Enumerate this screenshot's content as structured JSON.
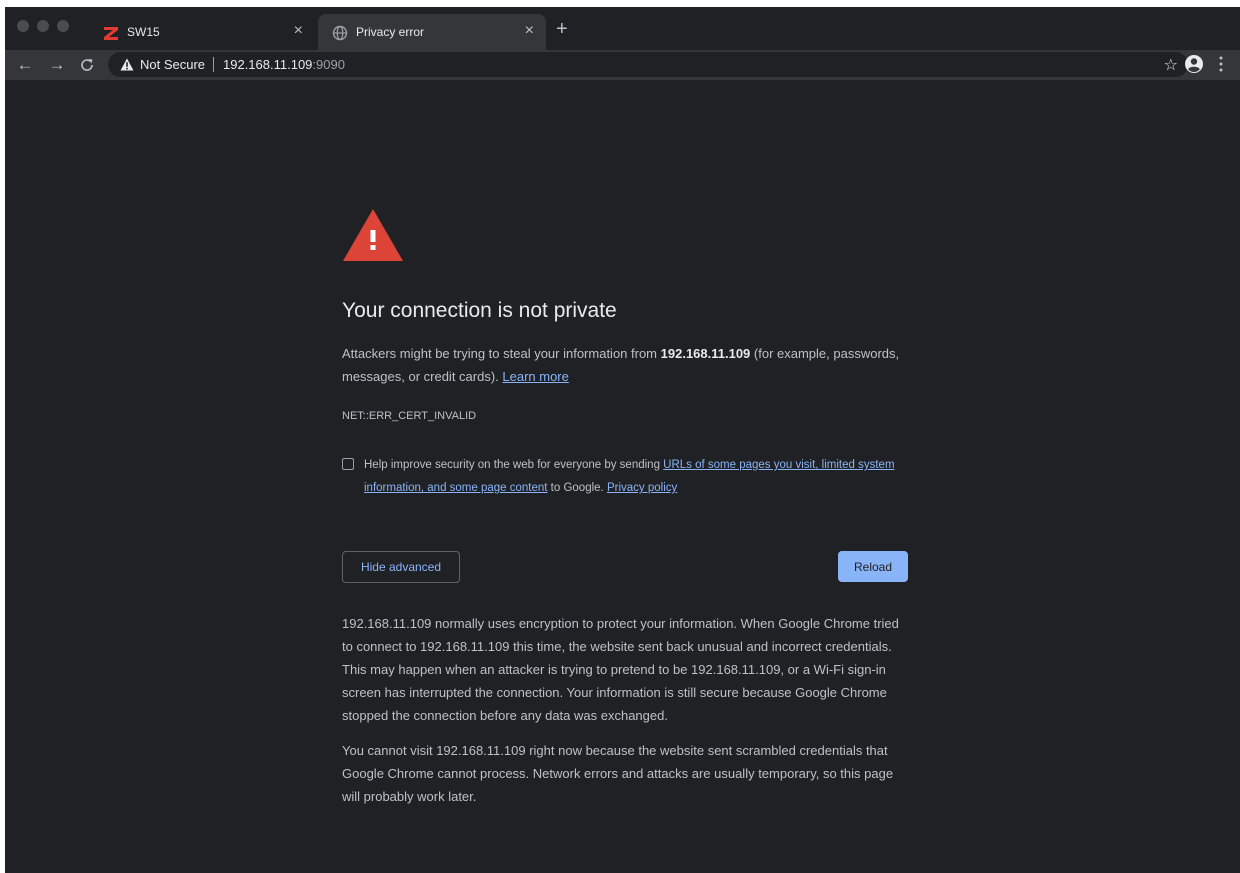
{
  "browser": {
    "tabs": [
      {
        "title": "SW15",
        "active": false,
        "icon": "z-logo-icon",
        "close": "×"
      },
      {
        "title": "Privacy error",
        "active": true,
        "icon": "globe-icon",
        "close": "×"
      }
    ],
    "new_tab": "+",
    "nav": {
      "back": "←",
      "forward": "→",
      "reload": "C"
    },
    "omnibox": {
      "security_label": "Not Secure",
      "url_host": "192.168.11.109",
      "url_port": ":9090"
    },
    "bookmark_star": "☆"
  },
  "page": {
    "heading": "Your connection is not private",
    "main_message": {
      "before": "Attackers might be trying to steal your information from ",
      "host": "192.168.11.109",
      "after": " (for example, passwords, messages, or credit cards). ",
      "learn_more": "Learn more"
    },
    "error_code": "NET::ERR_CERT_INVALID",
    "optin": {
      "before": "Help improve security on the web for everyone by sending ",
      "link1": "URLs of some pages you visit, limited system information, and some page content",
      "middle": " to Google. ",
      "link2": "Privacy policy"
    },
    "buttons": {
      "hide_advanced": "Hide advanced",
      "reload": "Reload"
    },
    "details": [
      "192.168.11.109 normally uses encryption to protect your information. When Google Chrome tried to connect to 192.168.11.109 this time, the website sent back unusual and incorrect credentials. This may happen when an attacker is trying to pretend to be 192.168.11.109, or a Wi-Fi sign-in screen has interrupted the connection. Your information is still secure because Google Chrome stopped the connection before any data was exchanged.",
      "You cannot visit 192.168.11.109 right now because the website sent scrambled credentials that Google Chrome cannot process. Network errors and attacks are usually temporary, so this page will probably work later."
    ]
  },
  "colors": {
    "background": "#202124",
    "toolbar": "#35363a",
    "link": "#8ab4f8",
    "warning_red": "#db4437",
    "text": "#bdc1c6"
  }
}
